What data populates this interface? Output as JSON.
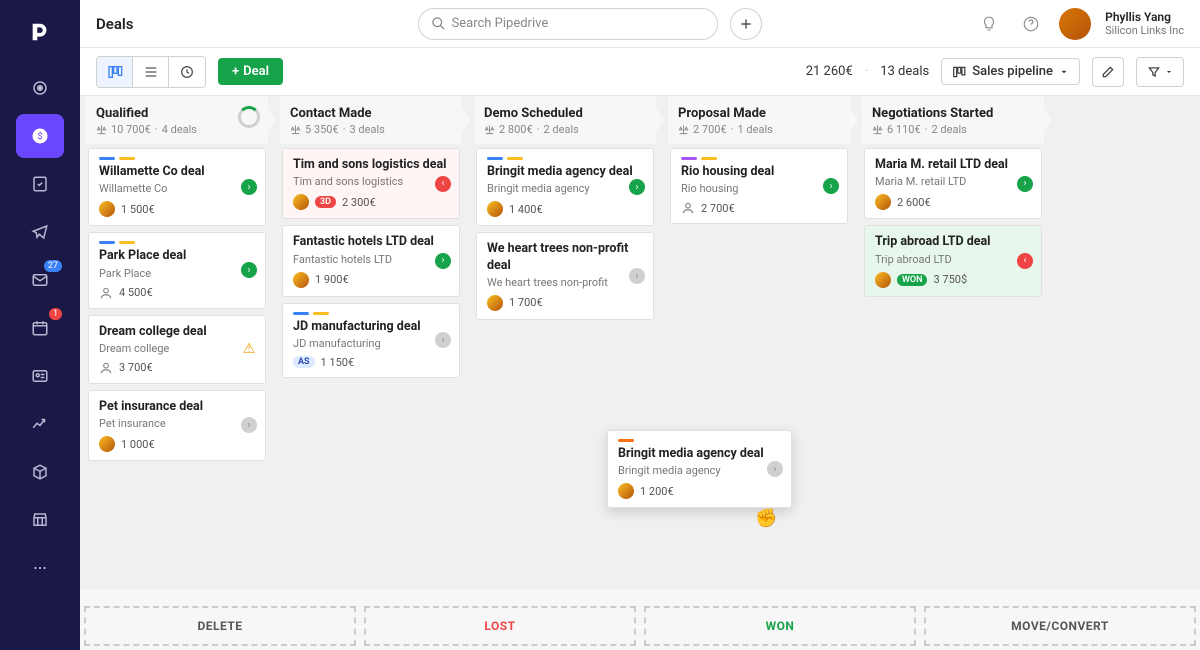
{
  "header": {
    "title": "Deals",
    "search_placeholder": "Search Pipedrive",
    "user_name": "Phyllis Yang",
    "user_company": "Silicon Links Inc"
  },
  "toolbar": {
    "deal_button": "Deal",
    "summary_amount": "21 260€",
    "summary_count": "13 deals",
    "pipeline_label": "Sales pipeline"
  },
  "sidebar": {
    "badge_mail": "27",
    "badge_cal": "1"
  },
  "columns": [
    {
      "title": "Qualified",
      "sum": "10 700€",
      "count": "4 deals",
      "spinner": true
    },
    {
      "title": "Contact Made",
      "sum": "5 350€",
      "count": "3 deals"
    },
    {
      "title": "Demo Scheduled",
      "sum": "2 800€",
      "count": "2 deals"
    },
    {
      "title": "Proposal Made",
      "sum": "2 700€",
      "count": "1 deals"
    },
    {
      "title": "Negotiations Started",
      "sum": "6 110€",
      "count": "2 deals"
    }
  ],
  "cards": {
    "c0": [
      {
        "title": "Willamette Co deal",
        "org": "Willamette Co",
        "value": "1 500€",
        "dots": [
          "blue",
          "yellow"
        ],
        "status": "green"
      },
      {
        "title": "Park Place deal",
        "org": "Park Place",
        "value": "4 500€",
        "dots": [
          "blue",
          "yellow"
        ],
        "status": "green",
        "people_icon": true
      },
      {
        "title": "Dream college deal",
        "org": "Dream college",
        "value": "3 700€",
        "dots": [],
        "status": "warn",
        "people_icon": true
      },
      {
        "title": "Pet insurance deal",
        "org": "Pet insurance",
        "value": "1 000€",
        "dots": [],
        "status": "gray"
      }
    ],
    "c1": [
      {
        "title": "Tim and sons logistics deal",
        "org": "Tim and sons logistics",
        "value": "2 300€",
        "dots": [],
        "status": "red",
        "overdue": true,
        "chip": "3D"
      },
      {
        "title": "Fantastic hotels LTD deal",
        "org": "Fantastic hotels LTD",
        "value": "1 900€",
        "dots": [],
        "status": "green"
      },
      {
        "title": "JD manufacturing deal",
        "org": "JD manufacturing",
        "value": "1 150€",
        "dots": [
          "blue",
          "yellow"
        ],
        "status": "gray",
        "as_chip": "AS"
      }
    ],
    "c2": [
      {
        "title": "Bringit media agency deal",
        "org": "Bringit media agency",
        "value": "1 400€",
        "dots": [
          "blue",
          "yellow"
        ],
        "status": "green"
      },
      {
        "title": "We heart trees non-profit deal",
        "org": "We heart trees non-profit",
        "value": "1 700€",
        "dots": [],
        "status": "gray"
      }
    ],
    "c3": [
      {
        "title": "Rio housing deal",
        "org": "Rio housing",
        "value": "2 700€",
        "dots": [
          "purple",
          "yellow"
        ],
        "status": "green",
        "people_icon": true
      }
    ],
    "c4": [
      {
        "title": "Maria M. retail LTD deal",
        "org": "Maria M. retail LTD",
        "value": "2 600€",
        "dots": [],
        "status": "green"
      },
      {
        "title": "Trip abroad LTD deal",
        "org": "Trip abroad LTD",
        "value": "3 750$",
        "dots": [],
        "status": "red",
        "won": true,
        "won_chip": "WON"
      }
    ]
  },
  "drag_card": {
    "title": "Bringit media agency deal",
    "org": "Bringit media agency",
    "value": "1 200€"
  },
  "drop": {
    "delete": "DELETE",
    "lost": "LOST",
    "won": "WON",
    "move": "MOVE/CONVERT"
  }
}
